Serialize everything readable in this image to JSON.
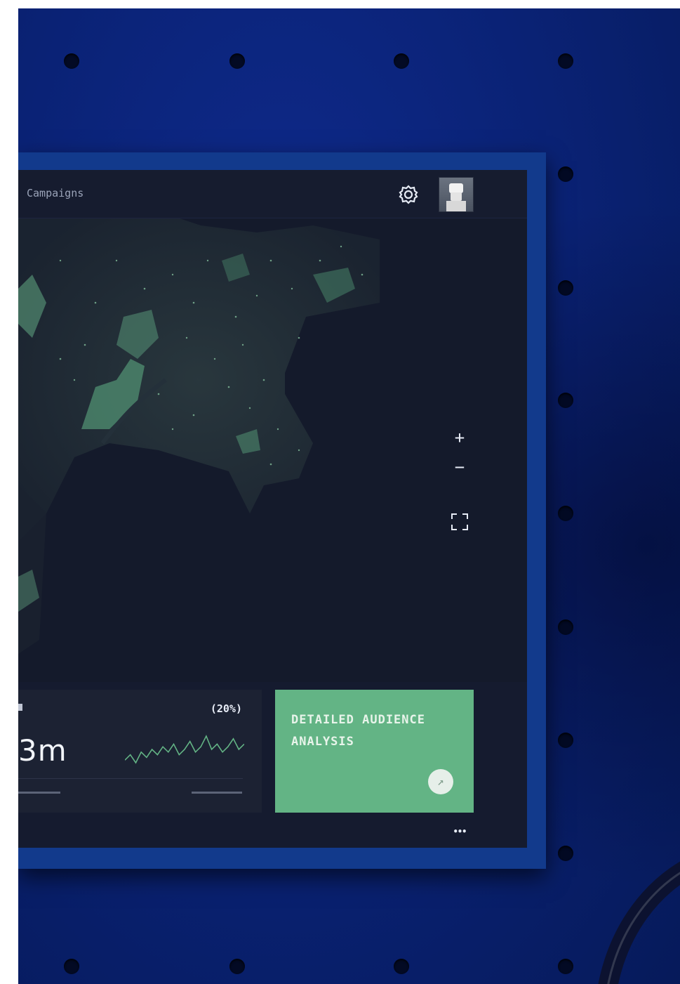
{
  "header": {
    "breadcrumb": "Campaigns"
  },
  "map_controls": {
    "zoom_in": "+",
    "zoom_out": "−",
    "more": "•••"
  },
  "stat": {
    "percent": "(20%)",
    "value": "3m",
    "trend_values": [
      3,
      5,
      2,
      6,
      4,
      7,
      5,
      8,
      6,
      9,
      5,
      7,
      10,
      6,
      8,
      12,
      7,
      9,
      6,
      8,
      11,
      7,
      9
    ]
  },
  "audience_card": {
    "title": "DETAILED AUDIENCE ANALYSIS"
  },
  "colors": {
    "accent_green": "#63b485",
    "panel_dark": "#151b2f",
    "wall_blue": "#0a2275"
  },
  "icons": [
    "gear-icon",
    "avatar",
    "zoom-in-icon",
    "zoom-out-icon",
    "fullscreen-icon",
    "search-icon",
    "more-icon",
    "arrow-icon"
  ]
}
